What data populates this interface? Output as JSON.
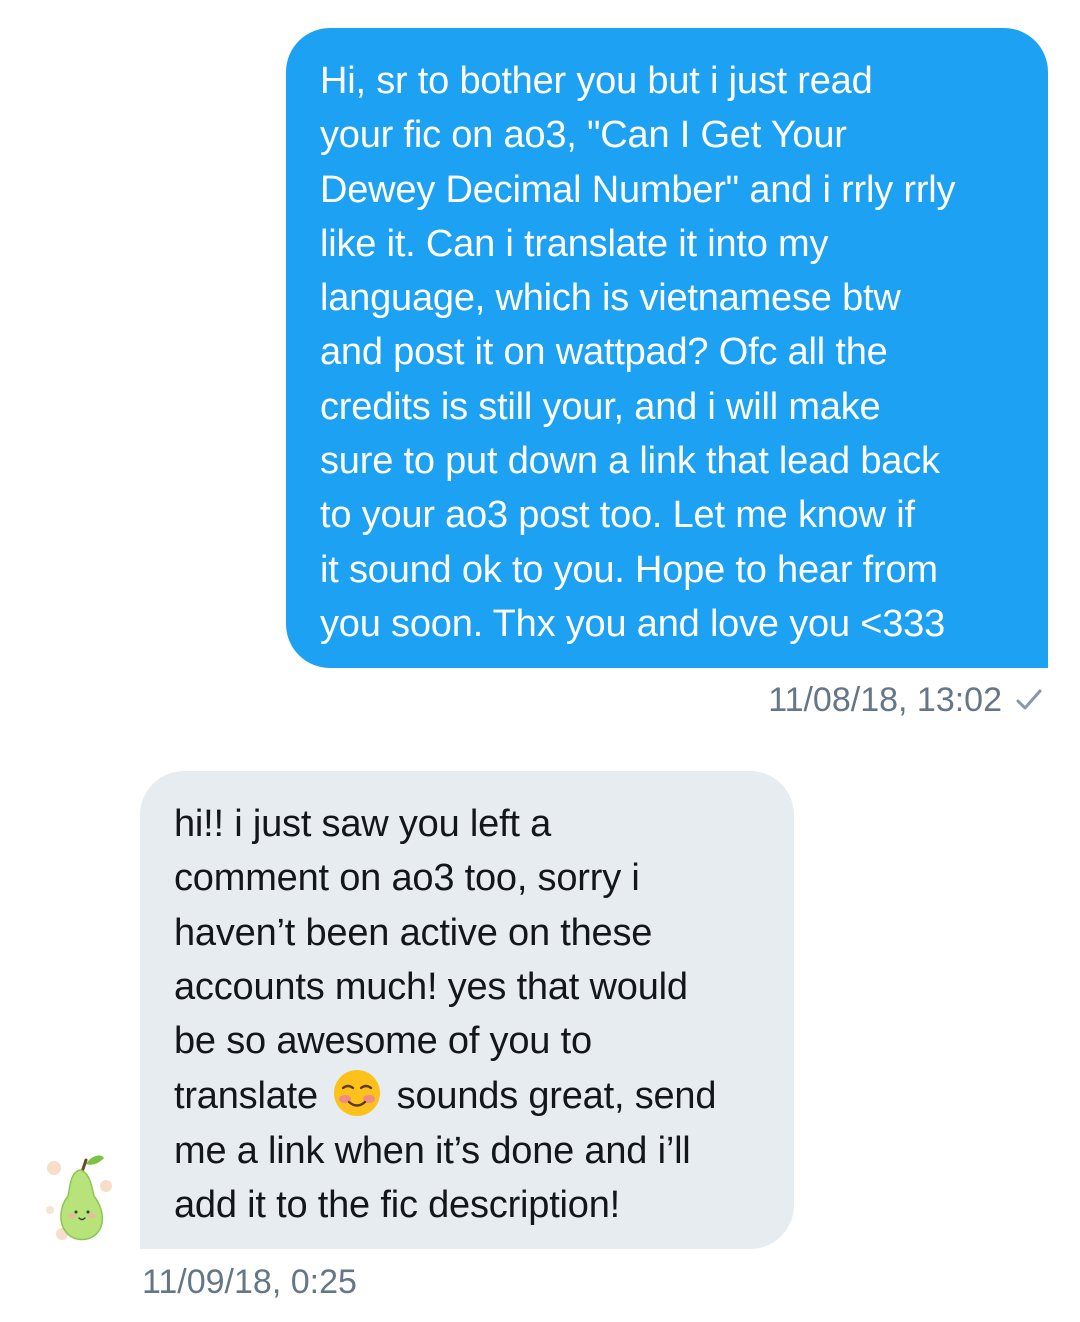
{
  "conversation": {
    "sent_message": {
      "lines": [
        "Hi, sr to bother you but i just read",
        "your fic on ao3, \"Can I Get Your",
        "Dewey Decimal Number\" and i rrly rrly",
        "like it. Can i translate it into my",
        "language, which is vietnamese btw",
        "and post it on wattpad? Ofc all the",
        "credits is still your, and i will make",
        "sure to put down a link that lead back",
        "to your ao3 post too. Let me know if",
        "it sound ok to you. Hope to hear from",
        "you soon. Thx you and love you <333"
      ],
      "timestamp": "11/08/18, 13:02",
      "status_icon": "check-icon",
      "bubble_color": "#1da1f2"
    },
    "received_message": {
      "lines": [
        "hi!! i just saw you left a",
        "comment on ao3 too, sorry i",
        "haven’t been active on these",
        "accounts much! yes that would",
        "be so awesome of you to"
      ],
      "line6_before_emoji": "translate",
      "emoji": "smiling-face-with-blush-emoji",
      "line6_after_emoji": "sounds great, send",
      "lines_end": [
        "me a link when it’s done and i’ll",
        "add it to the fic description!"
      ],
      "timestamp": "11/09/18, 0:25",
      "bubble_color": "#e6ecf0",
      "avatar_icon": "pear-avatar"
    }
  }
}
